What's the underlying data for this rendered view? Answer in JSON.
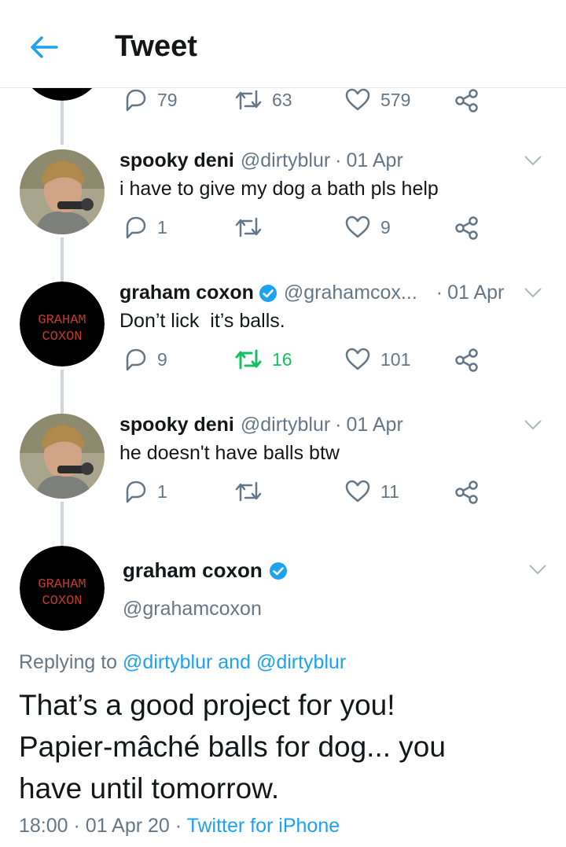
{
  "header": {
    "title": "Tweet"
  },
  "top_partial": {
    "replies": "79",
    "retweets": "63",
    "likes": "579"
  },
  "tweets": [
    {
      "name": "spooky deni",
      "handle": "@dirtyblur",
      "date": "01 Apr",
      "text": "i have to give my dog a bath pls help",
      "replies": "1",
      "retweets": "",
      "likes": "9",
      "verified": false,
      "retweeted": false
    },
    {
      "name": "graham coxon",
      "handle": "@grahamcox...",
      "date": "01 Apr",
      "text": "Don’t lick  it’s balls.",
      "replies": "9",
      "retweets": "16",
      "likes": "101",
      "verified": true,
      "retweeted": true
    },
    {
      "name": "spooky deni",
      "handle": "@dirtyblur",
      "date": "01 Apr",
      "text": "he doesn't have balls btw",
      "replies": "1",
      "retweets": "",
      "likes": "11",
      "verified": false,
      "retweeted": false
    }
  ],
  "main_tweet": {
    "name": "graham coxon",
    "handle": "@grahamcoxon",
    "replying_prefix": "Replying to",
    "reply_to_1": "@dirtyblur",
    "reply_and": "and",
    "reply_to_2": "@dirtyblur",
    "text_line_1": "That’s a good project for you!",
    "text_line_2": "Papier-mâché  balls for dog... you",
    "text_line_3": "have until tomorrow.",
    "time": "18:00",
    "date": "01 Apr 20",
    "source": "Twitter for iPhone"
  },
  "avatar_logo": {
    "line1": "GRAHAM",
    "line2": "COXON"
  },
  "colors": {
    "accent": "#1da1f2",
    "muted": "#657786",
    "retweet_active": "#17bf63",
    "logo_red": "#c0392b"
  }
}
